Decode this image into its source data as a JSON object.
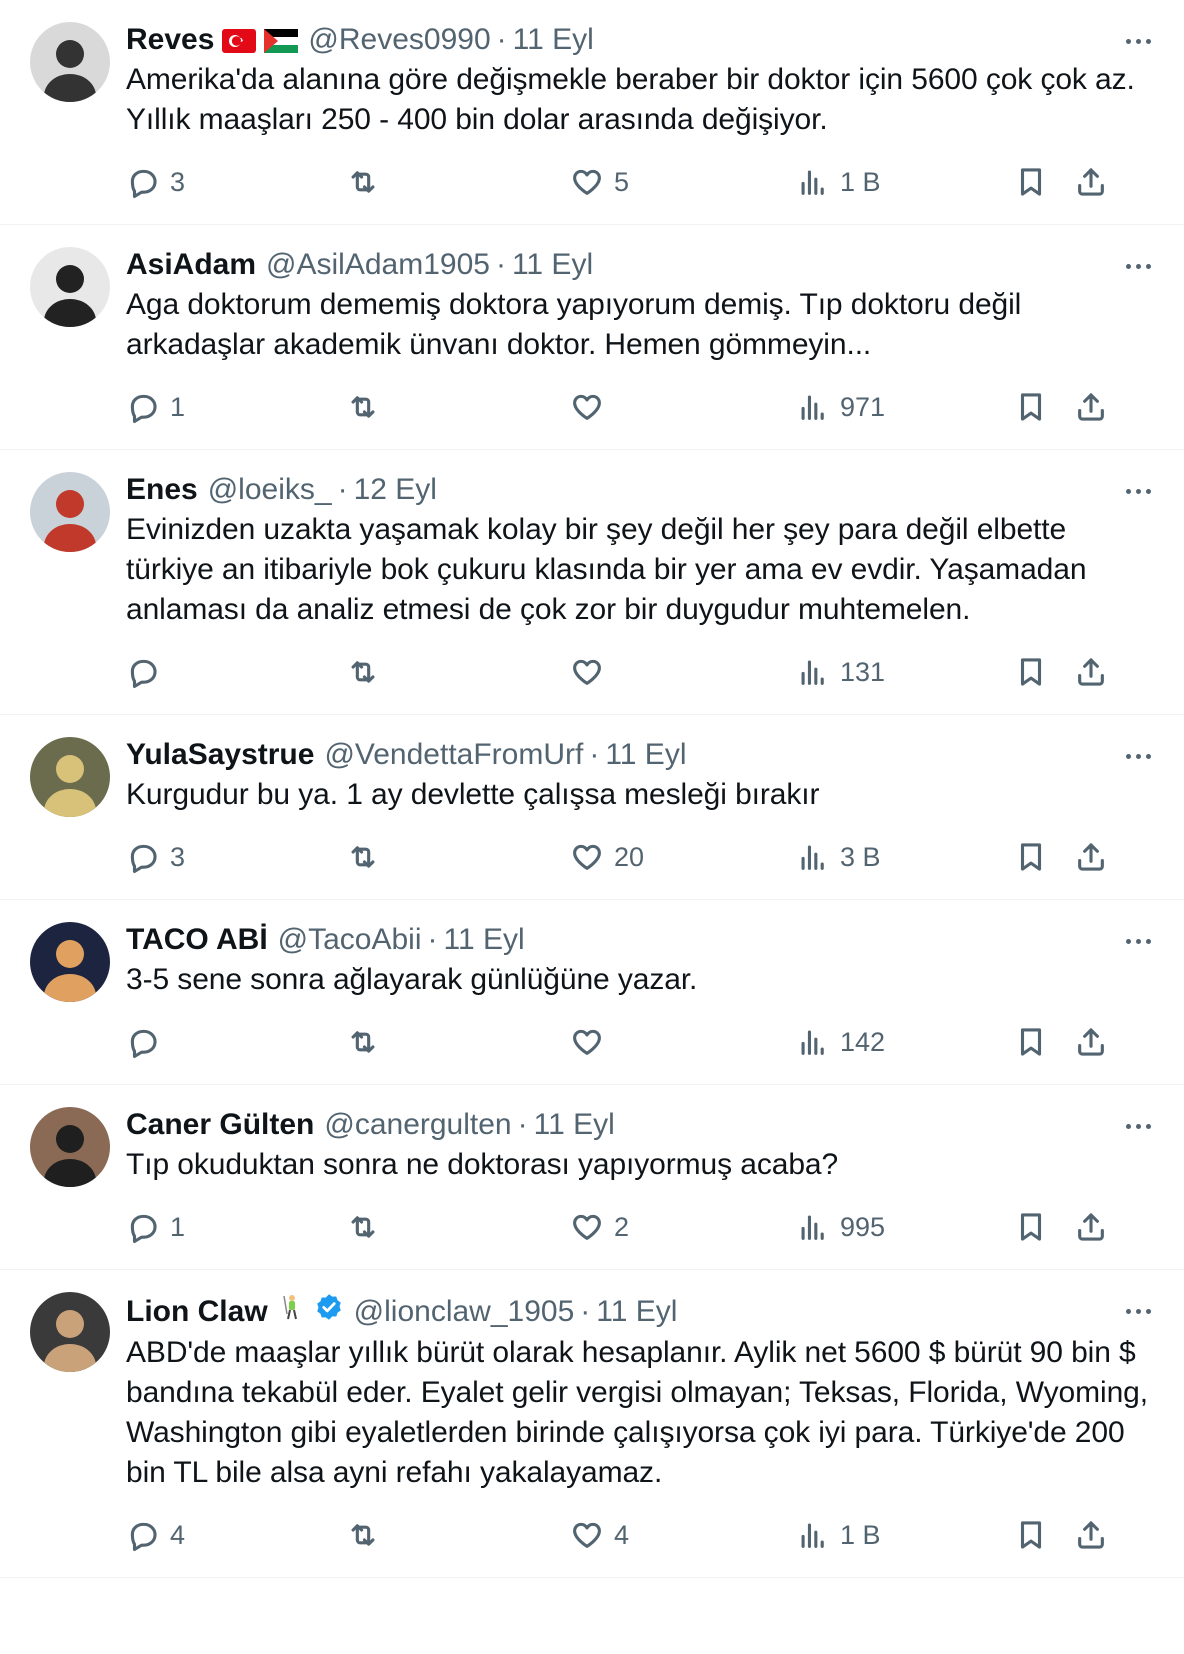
{
  "tweets": [
    {
      "name": "Reves",
      "handle": "@Reves0990",
      "date": "11 Eyl",
      "text": "Amerika'da alanına göre değişmekle beraber bir doktor için 5600 çok çok az. Yıllık maaşları 250 - 400 bin dolar arasında değişiyor.",
      "replies": "3",
      "retweets": "",
      "likes": "5",
      "views": "1 B",
      "avatar_colors": [
        "#d9d9d9",
        "#333333"
      ]
    },
    {
      "name": "AsiAdam",
      "handle": "@AsilAdam1905",
      "date": "11 Eyl",
      "text": "Aga doktorum dememiş doktora yapıyorum demiş. Tıp doktoru değil arkadaşlar akademik ünvanı doktor. Hemen gömmeyin...",
      "replies": "1",
      "retweets": "",
      "likes": "",
      "views": "971",
      "avatar_colors": [
        "#e8e8e8",
        "#222222"
      ]
    },
    {
      "name": "Enes",
      "handle": "@loeiks_",
      "date": "12 Eyl",
      "text": "Evinizden uzakta yaşamak kolay bir şey değil her şey para değil elbette türkiye an itibariyle bok çukuru klasında bir yer ama ev evdir. Yaşamadan anlaması da analiz etmesi de çok zor bir duygudur muhtemelen.",
      "replies": "",
      "retweets": "",
      "likes": "",
      "views": "131",
      "avatar_colors": [
        "#c9d1d9",
        "#c0392b"
      ]
    },
    {
      "name": "YulaSaystrue",
      "handle": "@VendettaFromUrf",
      "date": "11 Eyl",
      "text": "Kurgudur bu ya. 1 ay devlette çalışsa mesleği bırakır",
      "replies": "3",
      "retweets": "",
      "likes": "20",
      "views": "3 B",
      "avatar_colors": [
        "#6b6b4d",
        "#d8c27a"
      ]
    },
    {
      "name": "TACO ABİ",
      "handle": "@TacoAbii",
      "date": "11 Eyl",
      "text": "3-5 sene sonra ağlayarak günlüğüne yazar.",
      "replies": "",
      "retweets": "",
      "likes": "",
      "views": "142",
      "avatar_colors": [
        "#1c2440",
        "#e0a060"
      ]
    },
    {
      "name": "Caner Gülten",
      "handle": "@canergulten",
      "date": "11 Eyl",
      "text": "Tıp okuduktan sonra ne doktorası yapıyormuş acaba?",
      "replies": "1",
      "retweets": "",
      "likes": "2",
      "views": "995",
      "avatar_colors": [
        "#8a6a55",
        "#1f1f1f"
      ]
    },
    {
      "name": "Lion Claw",
      "handle": "@lionclaw_1905",
      "date": "11 Eyl",
      "text": "ABD'de maaşlar yıllık bürüt olarak hesaplanır. Aylik net 5600 $ bürüt 90 bin $ bandına tekabül eder. Eyalet gelir vergisi olmayan; Teksas, Florida, Wyoming, Washington gibi eyaletlerden birinde çalışıyorsa çok iyi para. Türkiye'de 200 bin TL bile alsa ayni refahı yakalayamaz.",
      "replies": "4",
      "retweets": "",
      "likes": "4",
      "views": "1 B",
      "avatar_colors": [
        "#3a3a3a",
        "#c9a27a"
      ]
    }
  ],
  "colors": {
    "text": "#0f1419",
    "muted": "#536471",
    "verified": "#1d9bf0",
    "divider": "#eff3f4"
  }
}
